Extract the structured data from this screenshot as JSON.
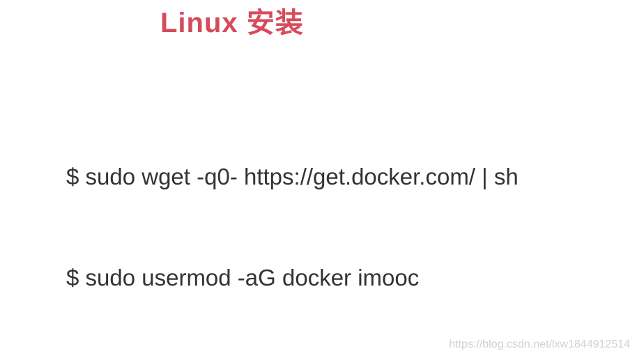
{
  "title": "Linux 安装",
  "commands": {
    "cmd1": "$ sudo wget -q0- https://get.docker.com/ | sh",
    "cmd2": "$ sudo usermod -aG docker imooc"
  },
  "watermark": "https://blog.csdn.net/lxw1844912514"
}
